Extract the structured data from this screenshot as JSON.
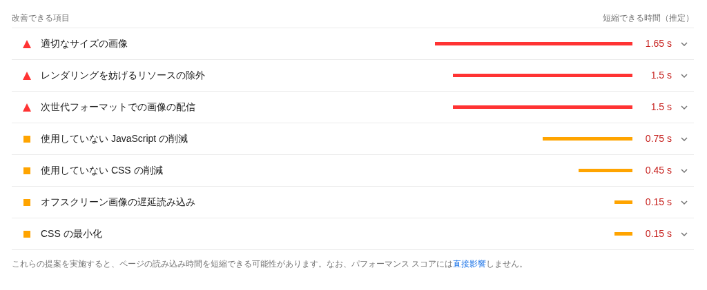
{
  "header": {
    "title": "改善できる項目",
    "savings_title": "短縮できる時間（推定）"
  },
  "opportunities": [
    {
      "kind": "fail",
      "title": "適切なサイズの画像",
      "savings": "1.65 s",
      "expanded": false
    },
    {
      "kind": "fail",
      "title": "レンダリングを妨げるリソースの除外",
      "savings": "1.5 s",
      "expanded": false
    },
    {
      "kind": "fail",
      "title": "次世代フォーマットでの画像の配信",
      "savings": "1.5 s",
      "expanded": false
    },
    {
      "kind": "average",
      "title": "使用していない JavaScript の削減",
      "savings": "0.75 s",
      "expanded": false
    },
    {
      "kind": "average",
      "title": "使用していない CSS の削減",
      "savings": "0.45 s",
      "expanded": false
    },
    {
      "kind": "average",
      "title": "オフスクリーン画像の遅延読み込み",
      "savings": "0.15 s",
      "expanded": false
    },
    {
      "kind": "average",
      "title": "CSS の最小化",
      "savings": "0.15 s",
      "expanded": false
    }
  ],
  "footer": {
    "text_before": "これらの提案を実施すると、ページの読み込み時間を短縮できる可能性があります。なお、パフォーマンス スコアには",
    "link": "直接影響",
    "text_after": "しません。"
  }
}
